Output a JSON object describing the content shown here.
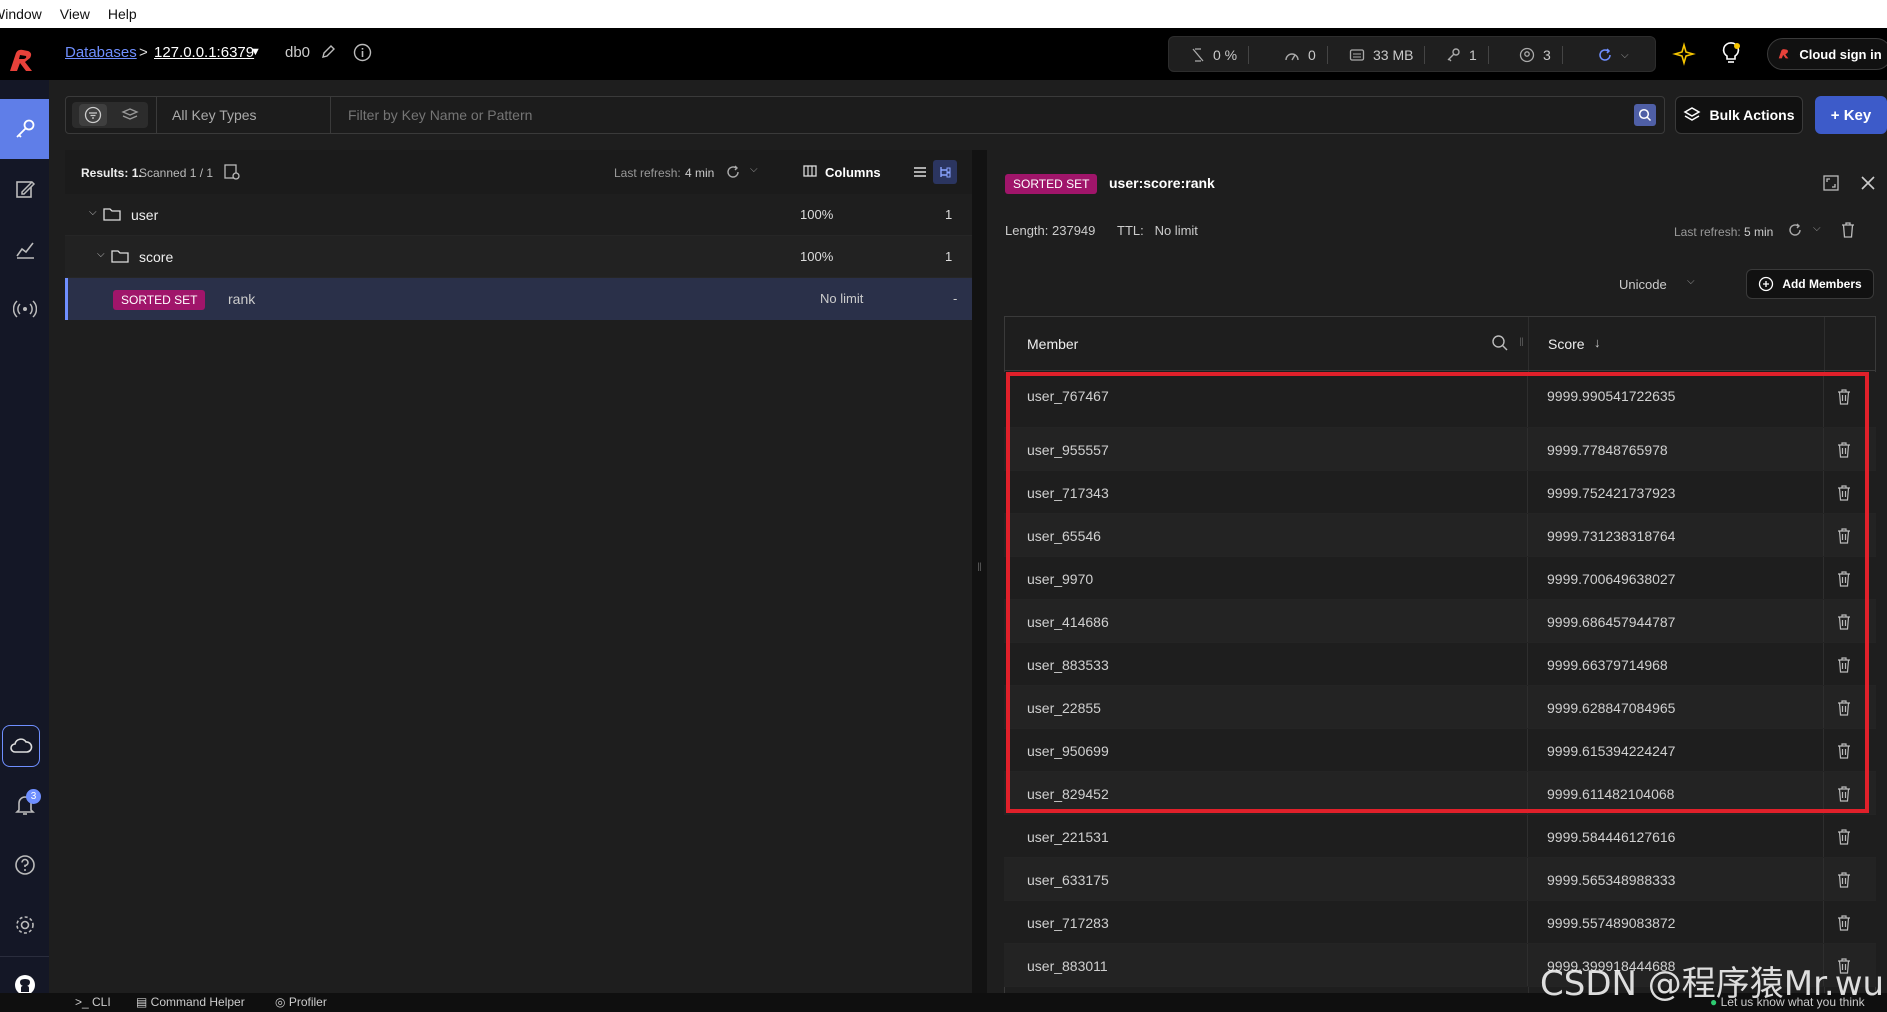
{
  "menubar": {
    "items": [
      "Window",
      "View",
      "Help"
    ]
  },
  "header": {
    "breadcrumb_root": "Databases",
    "breadcrumb_sep": ">",
    "host": "127.0.0.1:6379",
    "db": "db0",
    "stats": {
      "cpu": "0 %",
      "ops": "0",
      "memory": "33 MB",
      "keys": "1",
      "clients": "3"
    },
    "cloud_signin": "Cloud sign in"
  },
  "filter": {
    "key_types": "All Key Types",
    "placeholder": "Filter by Key Name or Pattern",
    "bulk_actions": "Bulk Actions",
    "add_key": "+ Key"
  },
  "tree": {
    "results_label": "Results:",
    "results_count": "1.",
    "scanned": "Scanned 1 / 1",
    "last_refresh_label": "Last refresh:",
    "last_refresh_value": "4 min",
    "columns_label": "Columns",
    "rows": [
      {
        "name": "user",
        "pct": "100%",
        "count": "1"
      },
      {
        "name": "score",
        "pct": "100%",
        "count": "1"
      }
    ],
    "key": {
      "type": "SORTED SET",
      "name": "rank",
      "ttl": "No limit",
      "size": "-"
    }
  },
  "details": {
    "type": "SORTED SET",
    "key_name": "user:score:rank",
    "length_label": "Length:",
    "length_value": "237949",
    "ttl_label": "TTL:",
    "ttl_value": "No limit",
    "last_refresh_label": "Last refresh:",
    "last_refresh_value": "5 min",
    "encoding": "Unicode",
    "add_members": "Add Members",
    "col_member": "Member",
    "col_score": "Score",
    "rows": [
      {
        "member": "user_767467",
        "score": "9999.990541722635"
      },
      {
        "member": "user_955557",
        "score": "9999.77848765978"
      },
      {
        "member": "user_717343",
        "score": "9999.752421737923"
      },
      {
        "member": "user_65546",
        "score": "9999.731238318764"
      },
      {
        "member": "user_9970",
        "score": "9999.700649638027"
      },
      {
        "member": "user_414686",
        "score": "9999.686457944787"
      },
      {
        "member": "user_883533",
        "score": "9999.66379714968"
      },
      {
        "member": "user_22855",
        "score": "9999.628847084965"
      },
      {
        "member": "user_950699",
        "score": "9999.615394224247"
      },
      {
        "member": "user_829452",
        "score": "9999.611482104068"
      },
      {
        "member": "user_221531",
        "score": "9999.584446127616"
      },
      {
        "member": "user_633175",
        "score": "9999.565348988333"
      },
      {
        "member": "user_717283",
        "score": "9999.557489083872"
      },
      {
        "member": "user_883011",
        "score": "9999.399918444688"
      }
    ]
  },
  "notifications_count": "3",
  "bottom": {
    "cli": "CLI",
    "helper": "Command Helper",
    "profiler": "Profiler",
    "feedback": "Let us know what you think"
  },
  "watermark": "CSDN @程序猿Mr.wu",
  "colors": {
    "accent": "#a0156a",
    "highlight_box": "#e0202a",
    "link": "#6f8fff",
    "nav_active": "#5f7ee8"
  }
}
